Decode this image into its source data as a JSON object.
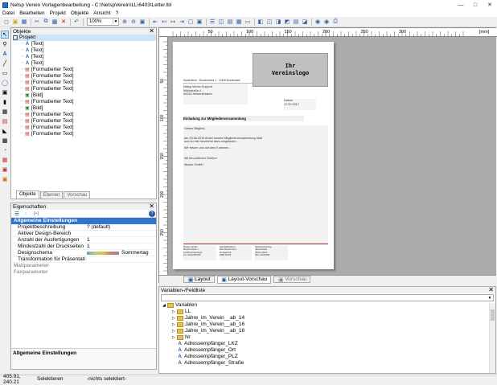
{
  "window": {
    "title": "Netsp Verein Vorlagenbearbeitung - C:\\NetspVerein\\LL\\6403\\Letter.lbl"
  },
  "menu": [
    "Datei",
    "Bearbeiten",
    "Projekt",
    "Objekte",
    "Ansicht",
    "?"
  ],
  "toolbar": {
    "zoom": "100%"
  },
  "objects_panel": {
    "title": "Objekte",
    "root": "Projekt",
    "items": [
      "[Text]",
      "[Text]",
      "[Text]",
      "[Text]",
      "[Formatierter Text]",
      "[Formatierter Text]",
      "[Formatierter Text]",
      "[Formatierter Text]",
      "[Bild]",
      "[Formatierter Text]",
      "[Bild]",
      "[Formatierter Text]",
      "[Formatierter Text]",
      "[Formatierter Text]",
      "[Formatierter Text]"
    ],
    "item_types": [
      "A",
      "A",
      "A",
      "A",
      "f",
      "f",
      "f",
      "f",
      "b",
      "f",
      "b",
      "f",
      "f",
      "f",
      "f"
    ],
    "tabs": [
      "Objekte",
      "Ebenen",
      "Vorschau"
    ]
  },
  "properties_panel": {
    "title": "Eigenschaften",
    "section_main": "Allgemeine Einstellungen",
    "rows": [
      {
        "name": "Projektbeschreibung",
        "value": "? (default)"
      },
      {
        "name": "Aktiver Design-Bereich",
        "value": ""
      },
      {
        "name": "Anzahl der Ausfertigungen",
        "value": "1"
      },
      {
        "name": "Mindestzahl der Druckseiten",
        "value": "1"
      },
      {
        "name": "Designschema",
        "value": "Sommertag"
      },
      {
        "name": "Transformation für Präsentati...",
        "value": ""
      }
    ],
    "section_mail": "Mailparameter",
    "section_fax": "Faxparameter",
    "description": "Allgemeine Einstellungen"
  },
  "ruler": {
    "h_labels": [
      "50",
      "100",
      "150",
      "200",
      "250",
      "300"
    ],
    "unit": "[mm]",
    "v_labels": [
      "50",
      "100",
      "150",
      "200",
      "250"
    ]
  },
  "letter": {
    "logo": "Ihr\nVereinslogo",
    "sender_line": "Musterfirma · Musterstraße 1 · 12345 Musterstadt",
    "recipient": [
      "Netsp Verein Support",
      "Mühlstraße 4",
      "64332 Heisenfeldsen"
    ],
    "date_label": "Datum",
    "date_value": "17.02.2017",
    "subject": "Einladung zur Mitgliederversammlung",
    "greeting": "Liebes Mitglied,",
    "body1": "am 23.06.2015 findet unsere Mitgliederversammlung statt",
    "body2": "und du bist herzlichst dazu eingeladen.",
    "body3": "Wir freuen uns auf dein Kommen.",
    "closing": "Mit freundlichen Grüßen",
    "signature": "Muster GmbH",
    "footer_cols": [
      "Muster GmbH\nMusterstraße 1\n12345 Musterstadt\nTel: 0123/456789",
      "Geschäftsführer:\nMax Mustermann\nAmtsgericht\nHRB 12345",
      "Bankverbindung:\nMusterbank\nIBAN: DE12...\nBIC: MUSTER"
    ]
  },
  "preview_tabs": [
    "Layout",
    "Layout-Vorschau",
    "Vorschau"
  ],
  "variables_panel": {
    "title": "Variablen-/Feldliste",
    "root": "Variablen",
    "items": [
      {
        "type": "folder",
        "label": "LL"
      },
      {
        "type": "folder",
        "label": "Jahre_im_Verein__ab_14"
      },
      {
        "type": "folder",
        "label": "Jahre_im_Verein__ab_16"
      },
      {
        "type": "folder",
        "label": "Jahre_im_Verein__ab_18"
      },
      {
        "type": "folder",
        "label": "Nr"
      },
      {
        "type": "var",
        "label": "Adressempfänger_LKZ"
      },
      {
        "type": "var",
        "label": "Adressempfänger_Ort"
      },
      {
        "type": "var",
        "label": "Adressempfänger_PLZ"
      },
      {
        "type": "var",
        "label": "Adressempfänger_Straße"
      }
    ]
  },
  "status": {
    "coords": "405.91, 240.21",
    "mode": "Selektieren",
    "selection": "-nichts selektiert-"
  }
}
